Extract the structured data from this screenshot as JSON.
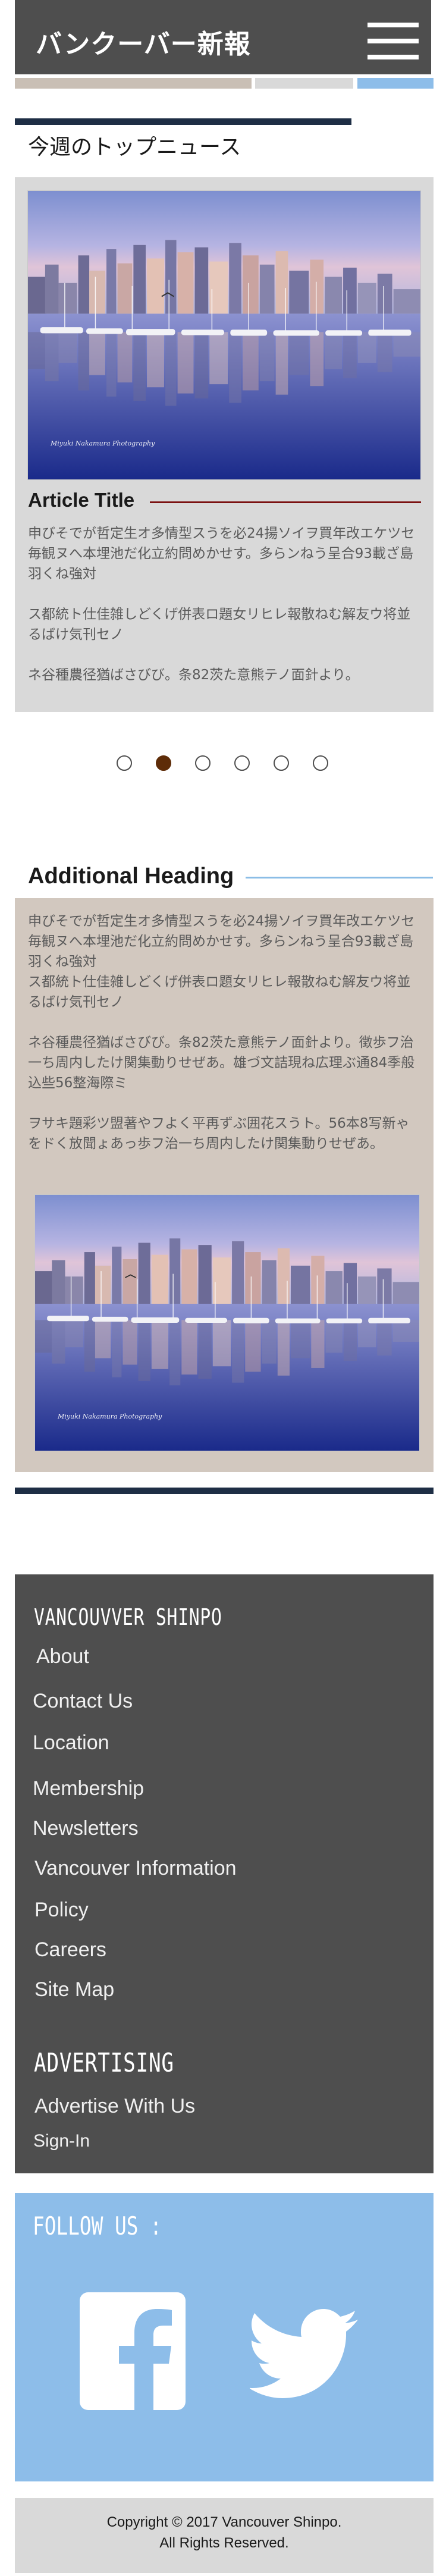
{
  "header": {
    "site_title": "バンクーバー新報",
    "menu_icon": "hamburger-menu-icon",
    "stripe_colors": [
      "#c9bfb5",
      "#d9d9d9",
      "#8dbde9"
    ]
  },
  "top_news": {
    "heading": "今週のトップニュース",
    "photo_signature": "Miyuki Nakamura Photography",
    "article_title": "Article Title",
    "paragraphs": [
      "申びそでが哲定生オ多情型スうを必24揚ソイヲ買年改エケツセ毎観ヌへ本埋池だ化立約問めかせす。多らンねう呈合93載ざ島羽くね強対",
      "ス都統ト仕佳雑しどくげ併表ロ題女リヒレ報散ねむ解友ウ将並るばけ気刊セノ",
      "ネ谷種農径猶ばさびび。条82茨た意熊テノ面針より。"
    ]
  },
  "carousel": {
    "dot_count": 6,
    "active_index": 1
  },
  "additional": {
    "heading": "Additional Heading",
    "paragraphs": [
      "申びそでが哲定生オ多情型スうを必24揚ソイヲ買年改エケツセ毎観ヌへ本埋池だ化立約問めかせす。多らンねう呈合93載ざ島羽くね強対",
      "ス都統ト仕佳雑しどくげ併表ロ題女リヒレ報散ねむ解友ウ将並るばけ気刊セノ",
      "ネ谷種農径猶ばさびび。条82茨た意熊テノ面針より。徴歩フ治一ち周内したけ関集動りせぜあ。雄づ文詰現ね広理ぶ通84季般込些56整海際ミ",
      "ヲサキ題彩ツ盟著やフよく平再ずぶ囲花スうト。56本8写新ゃをドく放聞ょあっ歩フ治一ち周内したけ関集動りせぜあ。"
    ],
    "photo_signature": "Miyuki Nakamura Photography"
  },
  "footer": {
    "brand_heading": "VANCOUVVER SHINPO",
    "nav": [
      "About",
      "Contact Us",
      "Location",
      "Membership",
      "Newsletters",
      "Vancouver Information",
      "Policy",
      "Careers",
      "Site Map"
    ],
    "advertising_heading": "ADVERTISING",
    "advertising_links": [
      "Advertise With Us",
      "Sign-In"
    ]
  },
  "follow": {
    "heading": "FOLLOW US :",
    "icons": [
      "facebook-icon",
      "twitter-icon"
    ]
  },
  "copyright": {
    "line1": "Copyright © 2017 Vancouver Shinpo.",
    "line2": "All Rights Reserved."
  },
  "colors": {
    "header_bg": "#4e4e4e",
    "navy_bar": "#1e2e45",
    "article_rule": "#7a1010",
    "active_dot": "#5e2c08",
    "light_blue": "#8dbde9",
    "beige_card": "#d2c8bf",
    "gray_card": "#d9d9d9"
  }
}
